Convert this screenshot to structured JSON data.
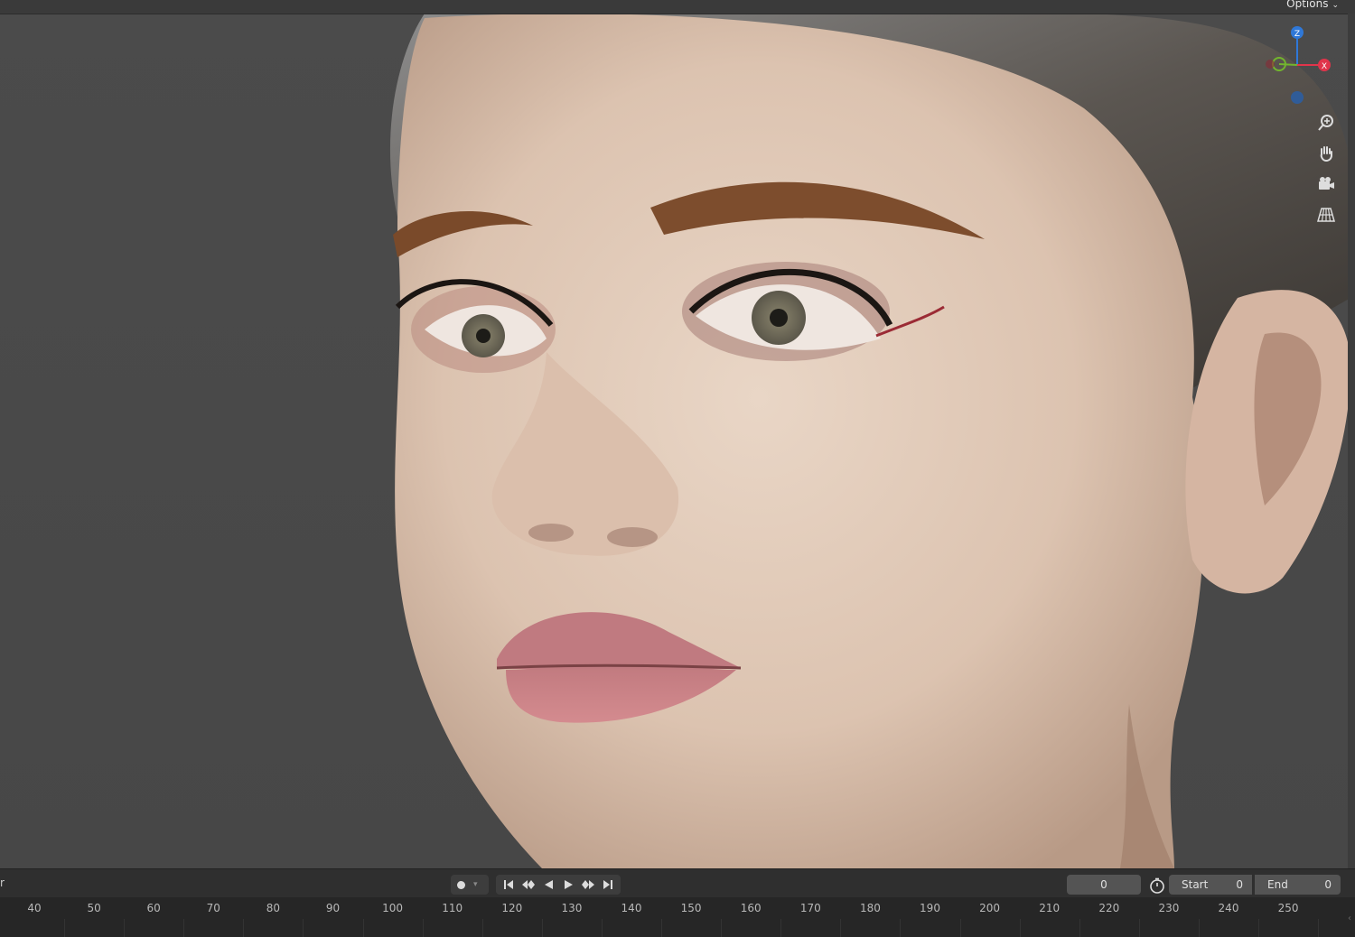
{
  "viewport": {
    "header": {
      "options_label": "Options"
    },
    "gizmo": {
      "axes": [
        "Z",
        "X"
      ]
    },
    "nav_tools": [
      "zoom-icon",
      "pan-hand-icon",
      "camera-view-icon",
      "perspective-grid-icon"
    ]
  },
  "timeline": {
    "editor_label": "r",
    "current_frame": "0",
    "start_label": "Start",
    "start_value": "0",
    "end_label": "End",
    "end_value": "0",
    "ruler_labels": [
      "40",
      "50",
      "60",
      "70",
      "80",
      "90",
      "100",
      "110",
      "120",
      "130",
      "140",
      "150",
      "160",
      "170",
      "180",
      "190",
      "200",
      "210",
      "220",
      "230",
      "240",
      "250"
    ]
  },
  "colors": {
    "axis_x": "#e0344b",
    "axis_y": "#72b52e",
    "axis_z": "#2f78d8",
    "viewport_bg": "#4a4a4a"
  }
}
